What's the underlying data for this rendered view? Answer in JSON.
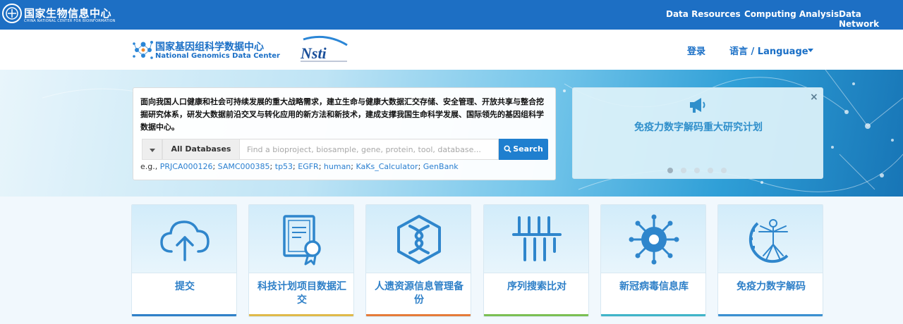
{
  "topbar": {
    "org_title": "国家生物信息中心",
    "org_subtitle": "CHINA NATIONAL CENTER FOR BIOINFORMATION",
    "nav": [
      "Data Resources",
      "Computing Analysis",
      "Data Network"
    ]
  },
  "header": {
    "center_cn": "国家基因组科学数据中心",
    "center_en": "National Genomics Data Center",
    "partner_logo_text": "Nsti",
    "login": "登录",
    "language": "语言 / Language"
  },
  "search": {
    "intro": "面向我国人口健康和社会可持续发展的重大战略需求，建立生命与健康大数据汇交存储、安全管理、开放共享与整合挖掘研究体系，研发大数据前沿交叉与转化应用的新方法和新技术，建成支撑我国生命科学发展、国际领先的基因组科学数据中心。",
    "db_selected": "All Databases",
    "placeholder": "Find a bioproject, biosample, gene, protein, tool, database...",
    "button": "Search",
    "examples_prefix": "e.g.,",
    "examples": [
      "PRJCA000126",
      "SAMC000385",
      "tp53",
      "EGFR",
      "human",
      "KaKs_Calculator",
      "GenBank"
    ]
  },
  "carousel": {
    "close": "×",
    "title": "免疫力数字解码重大研究计划",
    "slide_count": 5,
    "active_index": 0
  },
  "cards": [
    {
      "label": "提交",
      "icon": "cloud-upload-icon",
      "line_color": "#2f80c8"
    },
    {
      "label": "科技计划项目数据汇交",
      "icon": "certificate-icon",
      "line_color": "#e0b94a"
    },
    {
      "label": "人遗资源信息管理备份",
      "icon": "dna-hexagon-icon",
      "line_color": "#e57b3a"
    },
    {
      "label": "序列搜索比对",
      "icon": "sequence-bars-icon",
      "line_color": "#7bbf53"
    },
    {
      "label": "新冠病毒信息库",
      "icon": "virus-icon",
      "line_color": "#3fb4c8"
    },
    {
      "label": "免疫力数字解码",
      "icon": "vitruvian-icon",
      "line_color": "#3a8fd0"
    }
  ],
  "colors": {
    "brand_blue": "#1d6fc4",
    "link_blue": "#2a7fd0",
    "search_button": "#1f7fcf"
  }
}
